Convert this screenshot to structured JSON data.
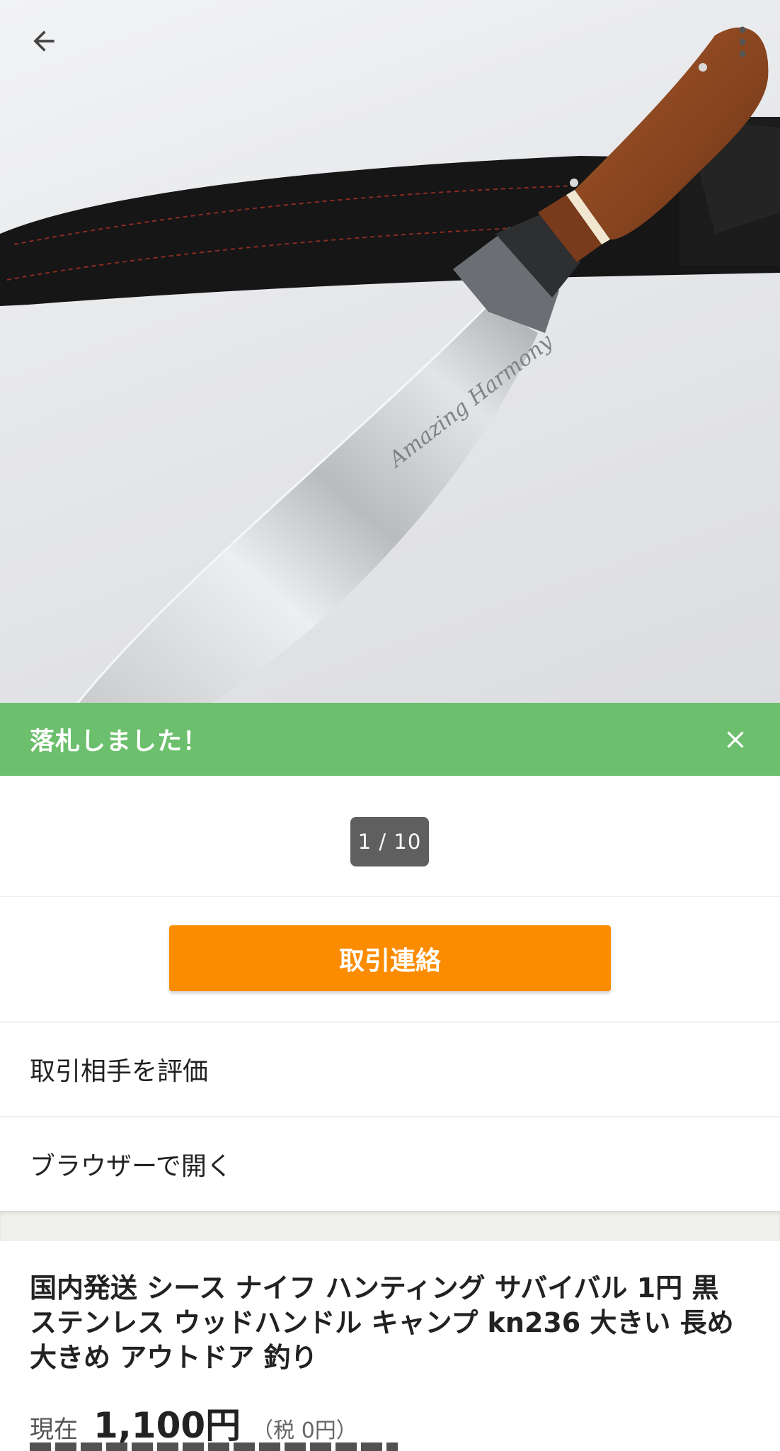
{
  "banner": {
    "text": "落札しました！"
  },
  "image_counter": "1 / 10",
  "product_image": {
    "engraving": "Amazing Harmony"
  },
  "actions": {
    "contact_button": "取引連絡",
    "menu": [
      "取引相手を評価",
      "ブラウザーで開く"
    ]
  },
  "item": {
    "title": "国内発送 シース ナイフ ハンティング サバイバル 1円 黒 ステンレス ウッドハンドル キャンプ kn236 大きい 長め 大きめ アウトドア 釣り",
    "price_label": "現在",
    "price": "1,100円",
    "tax": "（税 0円）"
  },
  "colors": {
    "banner": "#6cbf6c",
    "contact_button": "#fb8c00",
    "counter": "#5f5f5f"
  },
  "icons": [
    "back-arrow-icon",
    "more-vert-icon",
    "close-icon"
  ]
}
